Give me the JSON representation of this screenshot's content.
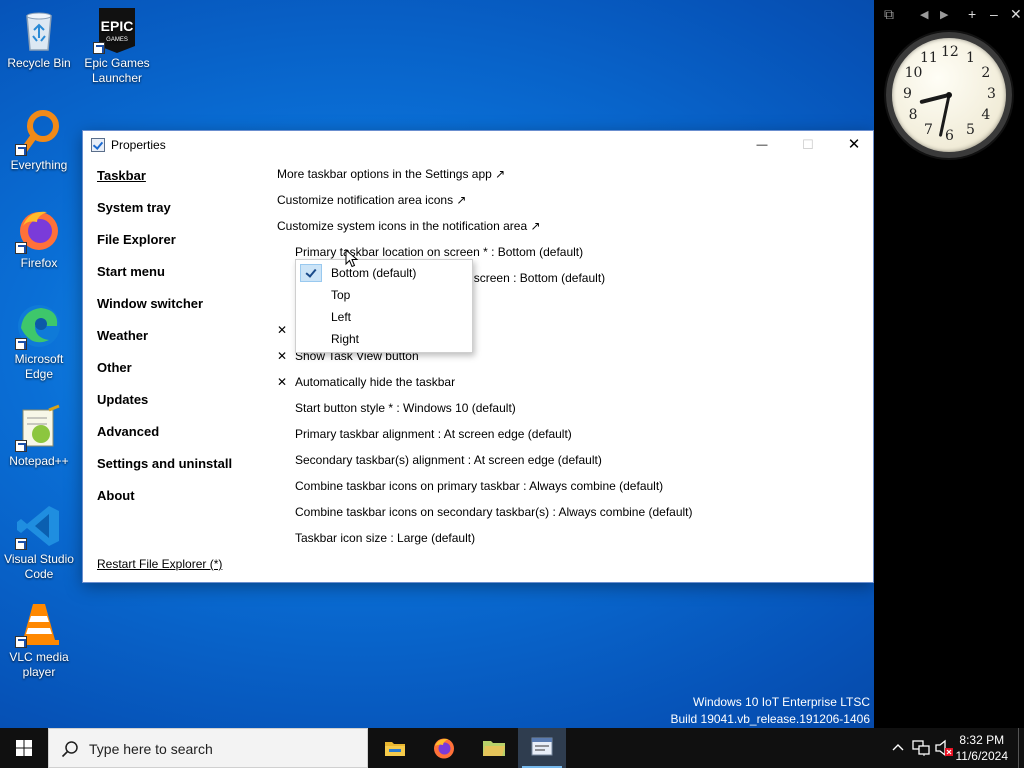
{
  "desktop": {
    "icons": [
      {
        "label": "Recycle Bin",
        "icon": "recycle-bin-icon"
      },
      {
        "label": "Epic Games Launcher",
        "icon": "epic-games-icon",
        "logo_text": "EPIC GAMES"
      },
      {
        "label": "Everything",
        "icon": "everything-search-icon"
      },
      {
        "label": "Firefox",
        "icon": "firefox-icon"
      },
      {
        "label": "Microsoft Edge",
        "icon": "edge-icon"
      },
      {
        "label": "Notepad++",
        "icon": "notepad-plus-plus-icon"
      },
      {
        "label": "Visual Studio Code",
        "icon": "vscode-icon"
      },
      {
        "label": "VLC media player",
        "icon": "vlc-icon"
      }
    ],
    "watermark": {
      "line1": "Windows 10 IoT Enterprise LTSC",
      "line2": "Build 19041.vb_release.191206-1406"
    }
  },
  "clock_gadget": {
    "toolbar": [
      "⧉",
      "◀",
      "▶",
      "+",
      "–",
      "✕"
    ],
    "numbers": [
      "12",
      "1",
      "2",
      "3",
      "4",
      "5",
      "6",
      "7",
      "8",
      "9",
      "10",
      "11"
    ],
    "time_hours": 8,
    "time_minutes": 32
  },
  "window": {
    "title": "Properties",
    "controls": {
      "minimize": "—",
      "maximize": "☐",
      "close": "✕"
    },
    "sidebar": [
      {
        "label": "Taskbar",
        "active": true
      },
      {
        "label": "System tray"
      },
      {
        "label": "File Explorer"
      },
      {
        "label": "Start menu"
      },
      {
        "label": "Window switcher"
      },
      {
        "label": "Weather"
      },
      {
        "label": "Other"
      },
      {
        "label": "Updates"
      },
      {
        "label": "Advanced"
      },
      {
        "label": "Settings and uninstall"
      },
      {
        "label": "About"
      }
    ],
    "restart_link": "Restart File Explorer (*)",
    "options": [
      {
        "label": "More taskbar options in the Settings app ↗"
      },
      {
        "label": "Customize notification area icons ↗"
      },
      {
        "label": "Customize system icons in the notification area ↗"
      },
      {
        "label": "Primary taskbar location on screen * : Bottom (default)"
      },
      {
        "label": "Secondary taskbar(s) location on screen : Bottom (default)"
      },
      {
        "label": ""
      },
      {
        "label": ""
      },
      {
        "label": "Show Task View button",
        "mark": "✕"
      },
      {
        "label": "Automatically hide the taskbar",
        "mark": "✕"
      },
      {
        "label": "Start button style * : Windows 10 (default)"
      },
      {
        "label": "Primary taskbar alignment : At screen edge (default)"
      },
      {
        "label": "Secondary taskbar(s) alignment : At screen edge (default)"
      },
      {
        "label": "Combine taskbar icons on primary taskbar : Always combine (default)"
      },
      {
        "label": "Combine taskbar icons on secondary taskbar(s) : Always combine (default)"
      },
      {
        "label": "Taskbar icon size : Large (default)"
      }
    ],
    "hidden_mark": "✕",
    "dropdown": {
      "items": [
        "Bottom (default)",
        "Top",
        "Left",
        "Right"
      ],
      "selected": 0
    }
  },
  "taskbar": {
    "search_placeholder": "Type here to search",
    "apps": [
      "file-explorer-icon",
      "firefox-icon",
      "folder-icon",
      "properties-app-icon"
    ],
    "tray": {
      "time": "8:32 PM",
      "date": "11/6/2024"
    }
  }
}
